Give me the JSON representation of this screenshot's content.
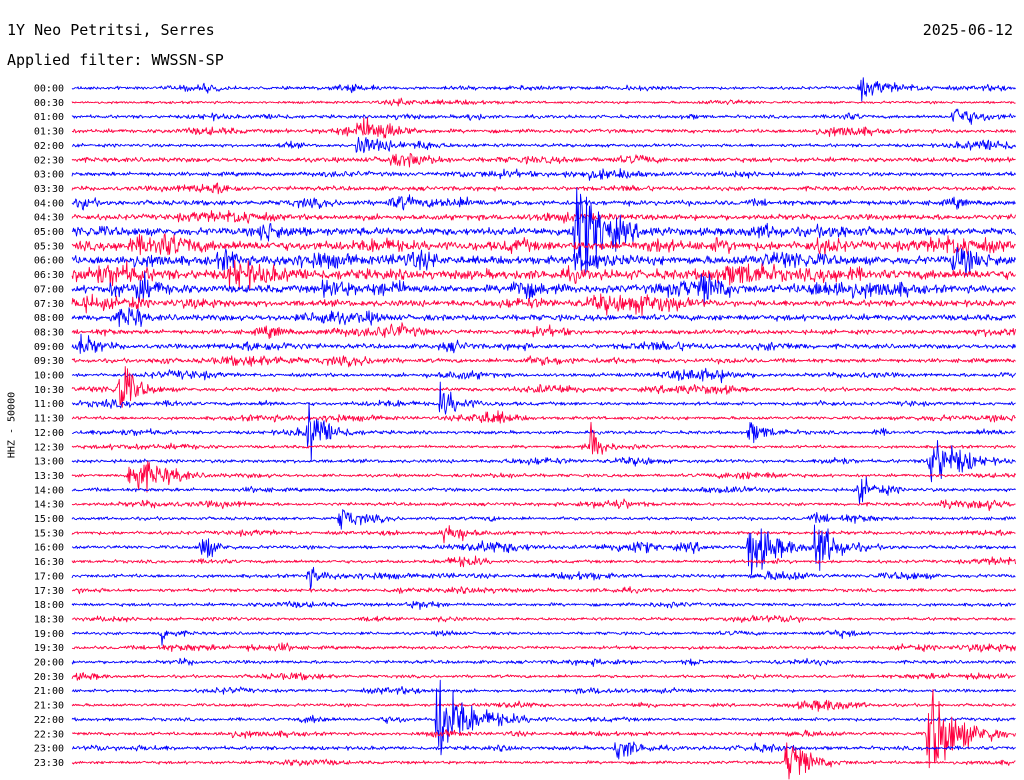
{
  "header": {
    "station": "1Y Neo Petritsi, Serres",
    "date": "2025-06-12",
    "filter": "Applied filter: WWSSN-SP"
  },
  "chart_data": {
    "type": "helicorder",
    "ylabel": "HHZ - 50000",
    "colors": [
      "#0000ff",
      "#ff0040"
    ],
    "grid": false,
    "row_labels": [
      "00:00",
      "00:30",
      "01:00",
      "01:30",
      "02:00",
      "02:30",
      "03:00",
      "03:30",
      "04:00",
      "04:30",
      "05:00",
      "05:30",
      "06:00",
      "06:30",
      "07:00",
      "07:30",
      "08:00",
      "08:30",
      "09:00",
      "09:30",
      "10:00",
      "10:30",
      "11:00",
      "11:30",
      "12:00",
      "12:30",
      "13:00",
      "13:30",
      "14:00",
      "14:30",
      "15:00",
      "15:30",
      "16:00",
      "16:30",
      "17:00",
      "17:30",
      "18:00",
      "18:30",
      "19:00",
      "19:30",
      "20:00",
      "20:30",
      "21:00",
      "21:30",
      "22:00",
      "22:30",
      "23:00",
      "23:30"
    ],
    "baseline_noise": [
      1.2,
      1.0,
      1.3,
      1.5,
      1.3,
      1.8,
      1.6,
      1.7,
      2.0,
      2.2,
      3.0,
      3.6,
      3.3,
      3.8,
      3.0,
      2.5,
      2.4,
      1.8,
      1.8,
      1.6,
      1.4,
      1.5,
      1.4,
      1.3,
      1.3,
      1.2,
      1.4,
      1.2,
      1.4,
      1.3,
      1.3,
      1.4,
      1.4,
      1.3,
      1.4,
      1.3,
      1.3,
      1.2,
      1.2,
      1.3,
      1.3,
      1.2,
      1.2,
      1.2,
      1.3,
      1.3,
      1.5,
      1.2
    ],
    "events": [
      {
        "row": 0,
        "minute": 25.0,
        "amplitude": 8,
        "duration_min": 3
      },
      {
        "row": 2,
        "minute": 28.0,
        "amplitude": 10,
        "duration_min": 2
      },
      {
        "row": 4,
        "minute": 9.0,
        "amplitude": 8,
        "duration_min": 3
      },
      {
        "row": 10,
        "minute": 16.0,
        "amplitude": 40,
        "duration_min": 2
      },
      {
        "row": 10,
        "minute": 6.0,
        "amplitude": 10,
        "duration_min": 1.5
      },
      {
        "row": 12,
        "minute": 28.0,
        "amplitude": 12,
        "duration_min": 2
      },
      {
        "row": 13,
        "minute": 5.0,
        "amplitude": 12,
        "duration_min": 3
      },
      {
        "row": 12,
        "minute": 16.0,
        "amplitude": 10,
        "duration_min": 2
      },
      {
        "row": 14,
        "minute": 2.0,
        "amplitude": 14,
        "duration_min": 1.5
      },
      {
        "row": 14,
        "minute": 14.0,
        "amplitude": 12,
        "duration_min": 1.5
      },
      {
        "row": 14,
        "minute": 20.0,
        "amplitude": 10,
        "duration_min": 1.5
      },
      {
        "row": 18,
        "minute": 0.2,
        "amplitude": 10,
        "duration_min": 1
      },
      {
        "row": 21,
        "minute": 1.5,
        "amplitude": 30,
        "duration_min": 1
      },
      {
        "row": 22,
        "minute": 11.7,
        "amplitude": 14,
        "duration_min": 1.5
      },
      {
        "row": 24,
        "minute": 7.5,
        "amplitude": 26,
        "duration_min": 1
      },
      {
        "row": 24,
        "minute": 21.5,
        "amplitude": 10,
        "duration_min": 1.5
      },
      {
        "row": 25,
        "minute": 16.5,
        "amplitude": 18,
        "duration_min": 0.8
      },
      {
        "row": 26,
        "minute": 27.2,
        "amplitude": 26,
        "duration_min": 2
      },
      {
        "row": 27,
        "minute": 1.8,
        "amplitude": 22,
        "duration_min": 2
      },
      {
        "row": 28,
        "minute": 25.0,
        "amplitude": 12,
        "duration_min": 1
      },
      {
        "row": 30,
        "minute": 8.5,
        "amplitude": 12,
        "duration_min": 1.2
      },
      {
        "row": 31,
        "minute": 11.8,
        "amplitude": 14,
        "duration_min": 1.3
      },
      {
        "row": 32,
        "minute": 4.1,
        "amplitude": 16,
        "duration_min": 0.8
      },
      {
        "row": 32,
        "minute": 21.5,
        "amplitude": 28,
        "duration_min": 2
      },
      {
        "row": 32,
        "minute": 23.6,
        "amplitude": 26,
        "duration_min": 1.5
      },
      {
        "row": 34,
        "minute": 7.5,
        "amplitude": 10,
        "duration_min": 0.8
      },
      {
        "row": 38,
        "minute": 2.8,
        "amplitude": 10,
        "duration_min": 0.8
      },
      {
        "row": 44,
        "minute": 11.6,
        "amplitude": 45,
        "duration_min": 2
      },
      {
        "row": 46,
        "minute": 17.3,
        "amplitude": 12,
        "duration_min": 1
      },
      {
        "row": 47,
        "minute": 22.7,
        "amplitude": 25,
        "duration_min": 1.5
      },
      {
        "row": 45,
        "minute": 27.2,
        "amplitude": 50,
        "duration_min": 2
      }
    ]
  }
}
